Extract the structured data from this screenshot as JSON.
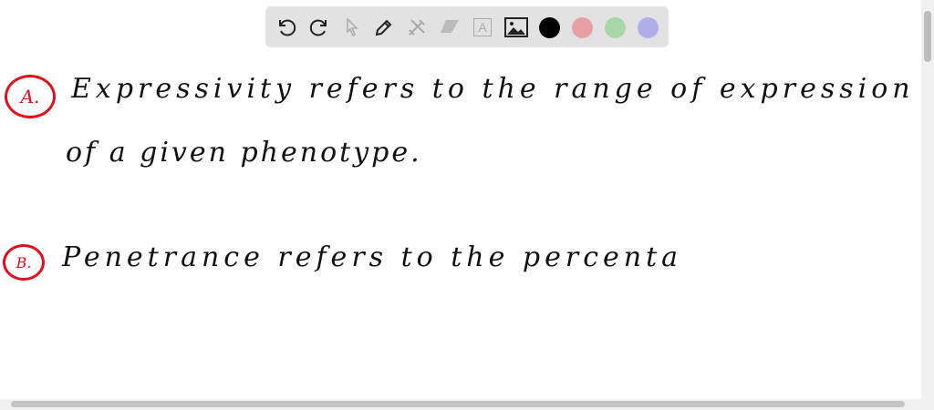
{
  "toolbar": {
    "tools": [
      "undo-icon",
      "redo-icon",
      "select-icon",
      "pen-icon",
      "tools-icon",
      "eraser-icon",
      "text-icon",
      "image-icon"
    ],
    "colors": [
      "#000000",
      "#e8a0a5",
      "#a9d6a9",
      "#b0aee8"
    ],
    "text_tool_glyph": "A"
  },
  "notes": {
    "a_label": "A.",
    "a_line1": "Expressivity refers to the range of expression",
    "a_line2": "of a given phenotype.",
    "b_label": "B.",
    "b_line1": "Penetrance refers to the percenta"
  }
}
